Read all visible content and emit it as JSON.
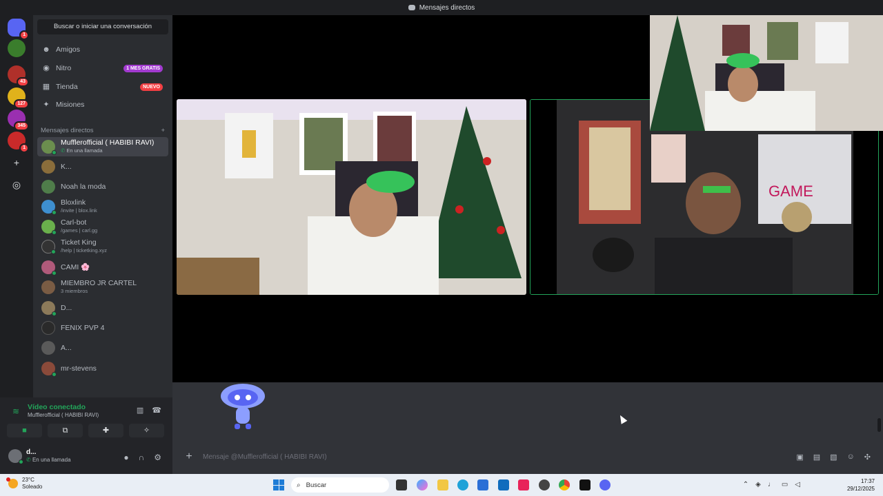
{
  "window": {
    "title": "Mensajes directos"
  },
  "servers": [
    {
      "name": "discord-home",
      "badge": "1",
      "color": "#5865f2"
    },
    {
      "name": "server-green",
      "badge": "",
      "color": "#3a7d2c"
    },
    {
      "name": "server-red",
      "badge": "43",
      "color": "#b0302a"
    },
    {
      "name": "server-yellow",
      "badge": "127",
      "color": "#e0b21b"
    },
    {
      "name": "server-purple",
      "badge": "345",
      "color": "#9a2fb0"
    },
    {
      "name": "server-flag",
      "badge": "1",
      "color": "#c92a2a"
    }
  ],
  "search": {
    "placeholder": "Buscar o iniciar una conversación"
  },
  "nav": [
    {
      "label": "Amigos",
      "icon": "friends-icon",
      "pill": ""
    },
    {
      "label": "Nitro",
      "icon": "nitro-icon",
      "pill": "1 MES GRATIS"
    },
    {
      "label": "Tienda",
      "icon": "shop-icon",
      "pill": "NUEVO"
    },
    {
      "label": "Misiones",
      "icon": "quests-icon",
      "pill": ""
    }
  ],
  "dm_header": {
    "label": "Mensajes directos",
    "add": "+"
  },
  "dms": [
    {
      "name": "Mufflerofficial ( HABIBI RAVI)",
      "sub": "En una llamada",
      "active": true,
      "color": "#6b8e4e"
    },
    {
      "name": "K...",
      "sub": "",
      "color": "#8a6d3b"
    },
    {
      "name": "Noah la moda",
      "sub": "",
      "color": "#4f7d4a"
    },
    {
      "name": "Bloxlink",
      "sub": "/invite | blox.link",
      "color": "#3e8fd0"
    },
    {
      "name": "Carl-bot",
      "sub": "/games | carl.gg",
      "color": "#6ab04c"
    },
    {
      "name": "Ticket King",
      "sub": "/help | ticketking.xyz",
      "color": "#333333"
    },
    {
      "name": "CAMI 🌸",
      "sub": "",
      "color": "#b05a7a"
    },
    {
      "name": "MIEMBRO JR CARTEL",
      "sub": "3 miembros",
      "color": "#7a5c44"
    },
    {
      "name": "D...",
      "sub": "",
      "color": "#8c7a5a"
    },
    {
      "name": "FENIX PVP 4",
      "sub": "",
      "color": "#2a2a2a"
    },
    {
      "name": "A...",
      "sub": "",
      "color": "#5a5a5a"
    },
    {
      "name": "mr-stevens",
      "sub": "",
      "color": "#8a4a3a"
    }
  ],
  "voice": {
    "status": "Vídeo conectado",
    "channel": "Mufflerofficial ( HABIBI RAVI)"
  },
  "user": {
    "name": "d...",
    "status": "En una llamada"
  },
  "composer": {
    "placeholder": "Mensaje @Mufflerofficial ( HABIBI RAVI)"
  },
  "taskbar": {
    "temp": "23°C",
    "weather": "Soleado",
    "search": "Buscar",
    "time": "17:37",
    "date": "29/12/2025"
  }
}
